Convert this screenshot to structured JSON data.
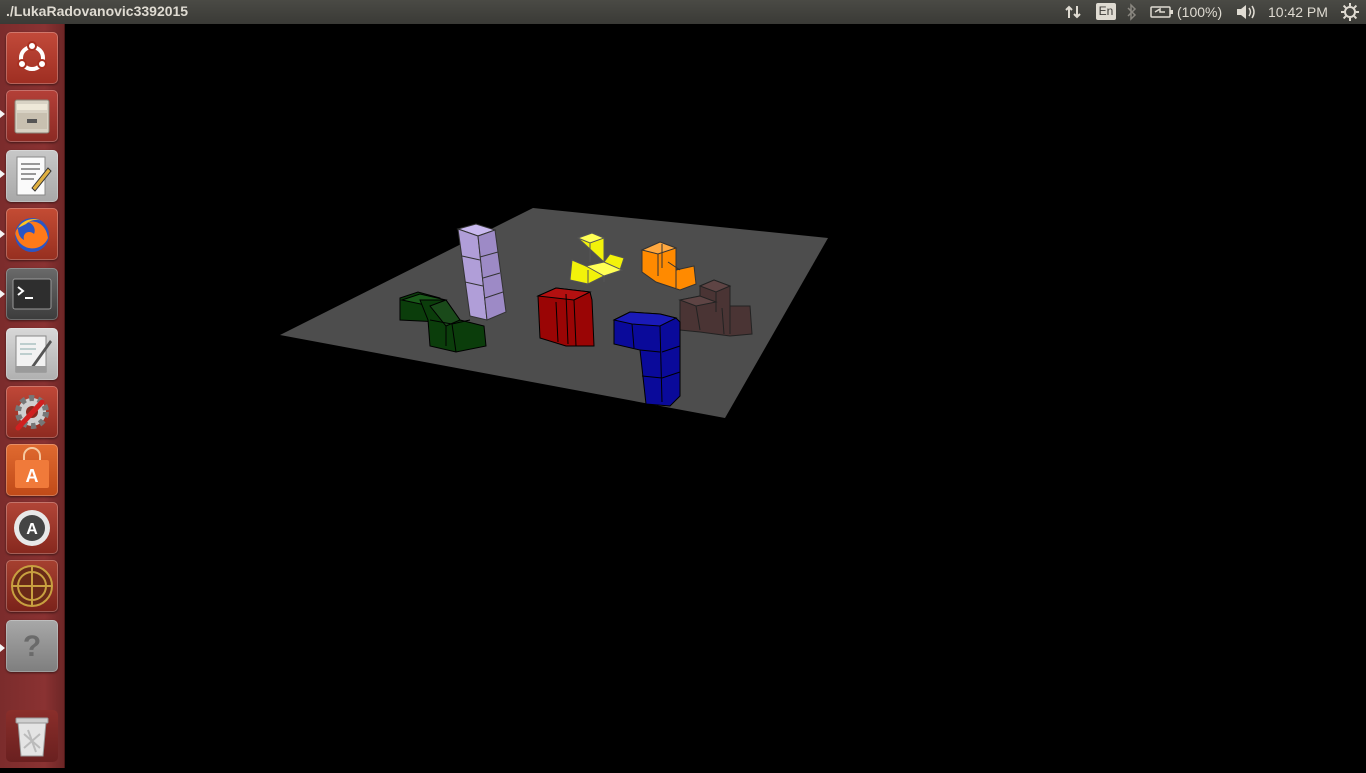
{
  "top_panel": {
    "window_title": "./LukaRadovanovic3392015",
    "keyboard_layout": "En",
    "battery_percent": "(100%)",
    "clock": "10:42 PM",
    "icons": [
      "network-arrows-icon",
      "keyboard-layout-indicator",
      "bluetooth-icon",
      "battery-icon",
      "volume-icon",
      "settings-gear-icon"
    ]
  },
  "launcher": {
    "items": [
      {
        "name": "ubuntu-dash",
        "icon": "ubuntu-logo-icon",
        "running": false
      },
      {
        "name": "files",
        "icon": "file-cabinet-icon",
        "running": true
      },
      {
        "name": "text-editor",
        "icon": "text-editor-icon",
        "running": true
      },
      {
        "name": "firefox",
        "icon": "firefox-icon",
        "running": true
      },
      {
        "name": "terminal",
        "icon": "terminal-icon",
        "running": true
      },
      {
        "name": "libreoffice-writer",
        "icon": "document-pen-icon",
        "running": false
      },
      {
        "name": "system-settings",
        "icon": "gear-wrench-icon",
        "running": false
      },
      {
        "name": "ubuntu-software",
        "icon": "shopping-bag-icon",
        "running": false
      },
      {
        "name": "software-updater",
        "icon": "updater-icon",
        "running": false
      },
      {
        "name": "game-app",
        "icon": "crosshair-circle-icon",
        "running": false
      },
      {
        "name": "unknown-app",
        "icon": "question-mark-icon",
        "running": true
      },
      {
        "name": "trash",
        "icon": "trash-icon",
        "running": false
      }
    ]
  },
  "scene": {
    "background_color": "#000000",
    "board_color": "#4d4d4d",
    "pieces": [
      {
        "name": "lavender-column",
        "color": "#b09ed8"
      },
      {
        "name": "green-s-piece",
        "color": "#0b3d0b"
      },
      {
        "name": "yellow-piece",
        "color": "#f2f20a"
      },
      {
        "name": "orange-piece",
        "color": "#ff8a00"
      },
      {
        "name": "red-block",
        "color": "#9a0505"
      },
      {
        "name": "brown-piece",
        "color": "#4a3434"
      },
      {
        "name": "blue-l-piece",
        "color": "#0a0a9a"
      }
    ]
  }
}
